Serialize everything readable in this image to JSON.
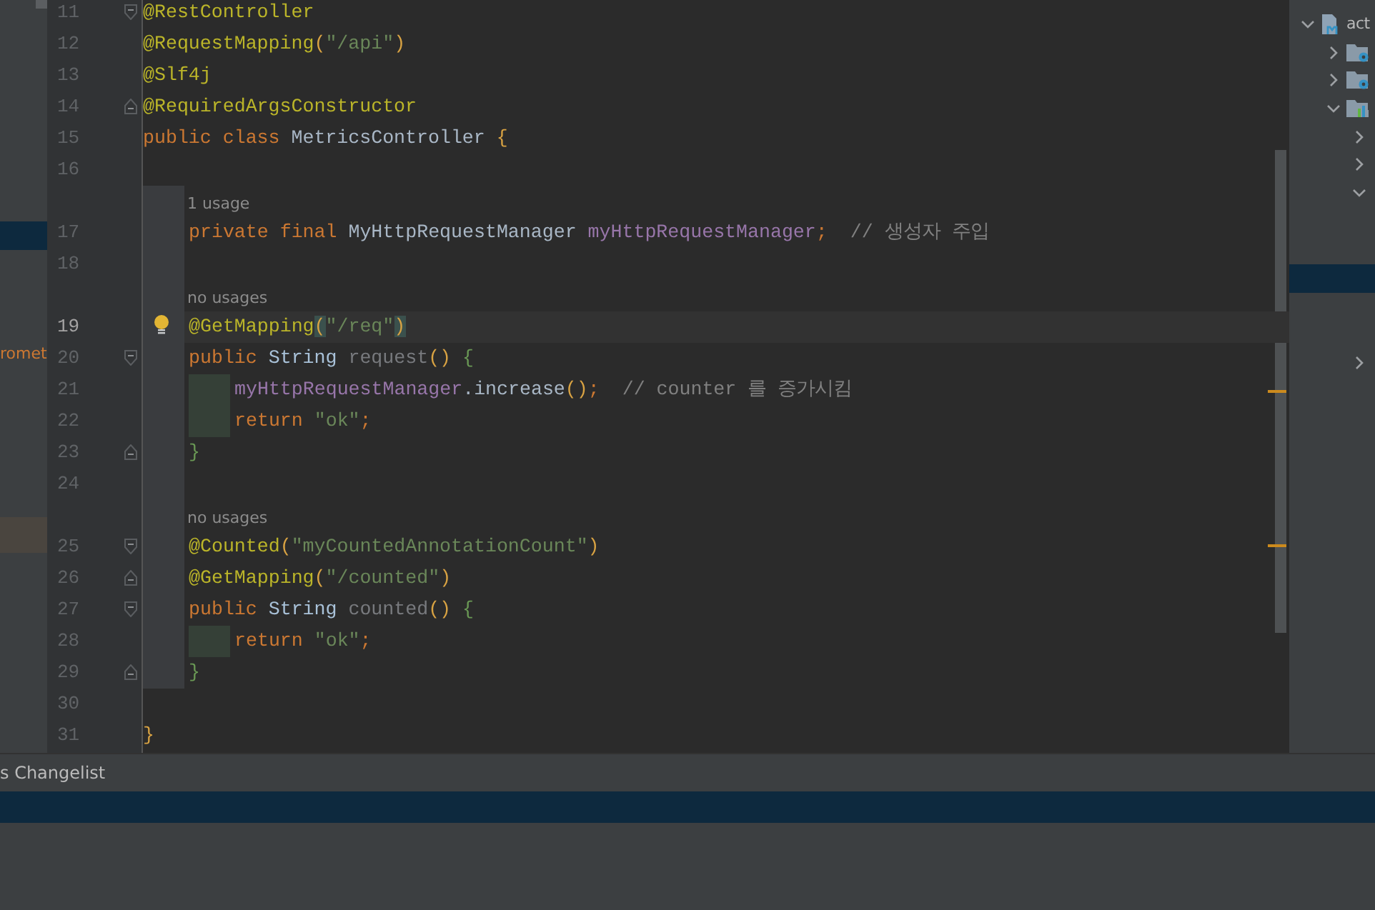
{
  "project_panel": {
    "items": [
      {
        "kind": "selection",
        "selected": true
      },
      {
        "kind": "label",
        "label": "romet"
      },
      {
        "kind": "highlight",
        "selected": false
      }
    ]
  },
  "editor": {
    "lines": [
      {
        "kind": "code",
        "number": "11",
        "fold_start": true,
        "tokens": [
          {
            "kind": "annotation",
            "text": "@RestController"
          }
        ]
      },
      {
        "kind": "code",
        "number": "12",
        "tokens": [
          {
            "kind": "annotation",
            "text": "@RequestMapping"
          },
          {
            "kind": "paren",
            "text": "("
          },
          {
            "kind": "string",
            "text": "\"/api\""
          },
          {
            "kind": "paren",
            "text": ")"
          }
        ]
      },
      {
        "kind": "code",
        "number": "13",
        "tokens": [
          {
            "kind": "annotation",
            "text": "@Slf4j"
          }
        ]
      },
      {
        "kind": "code",
        "number": "14",
        "fold_end": true,
        "tokens": [
          {
            "kind": "annotation",
            "text": "@RequiredArgsConstructor"
          }
        ]
      },
      {
        "kind": "code",
        "number": "15",
        "tokens": [
          {
            "kind": "keyword",
            "text": "public class "
          },
          {
            "kind": "plain",
            "text": "MetricsController "
          },
          {
            "kind": "paren",
            "text": "{"
          }
        ]
      },
      {
        "kind": "code",
        "number": "16"
      },
      {
        "kind": "hint",
        "text": "1 usage",
        "class_guide": true
      },
      {
        "kind": "code",
        "number": "17",
        "class_guide": true,
        "tokens": [
          {
            "kind": "keyword",
            "text": "private final "
          },
          {
            "kind": "plain",
            "text": "MyHttpRequestManager "
          },
          {
            "kind": "field",
            "text": "myHttpRequestManager"
          },
          {
            "kind": "keyword",
            "text": ";"
          },
          {
            "kind": "comment",
            "text": "  // 생성자 주입"
          }
        ]
      },
      {
        "kind": "code",
        "number": "18",
        "class_guide": true
      },
      {
        "kind": "hint",
        "text": "no usages",
        "class_guide": true
      },
      {
        "kind": "code",
        "number": "19",
        "current": true,
        "bulb": true,
        "class_guide": true,
        "tokens": [
          {
            "kind": "annotation",
            "text": "@GetMapping"
          },
          {
            "kind": "paren",
            "text": "(",
            "matched": true
          },
          {
            "kind": "string",
            "text": "\"/req\""
          },
          {
            "kind": "paren",
            "text": ")",
            "matched": true
          }
        ]
      },
      {
        "kind": "code",
        "number": "20",
        "fold_start": true,
        "class_guide": true,
        "tokens": [
          {
            "kind": "keyword",
            "text": "public "
          },
          {
            "kind": "type",
            "text": "String "
          },
          {
            "kind": "unused",
            "text": "request"
          },
          {
            "kind": "paren",
            "text": "()"
          },
          {
            "kind": "brace",
            "text": " {"
          }
        ]
      },
      {
        "kind": "code",
        "number": "21",
        "class_guide": true,
        "method_guide": true,
        "tokens": [
          {
            "kind": "field",
            "text": "myHttpRequestManager"
          },
          {
            "kind": "plain",
            "text": ".increase"
          },
          {
            "kind": "paren",
            "text": "()"
          },
          {
            "kind": "keyword",
            "text": ";"
          },
          {
            "kind": "comment",
            "text": "  // counter 를 증가시킴"
          }
        ]
      },
      {
        "kind": "code",
        "number": "22",
        "class_guide": true,
        "method_guide": true,
        "tokens": [
          {
            "kind": "keyword",
            "text": "return "
          },
          {
            "kind": "string",
            "text": "\"ok\""
          },
          {
            "kind": "keyword",
            "text": ";"
          }
        ]
      },
      {
        "kind": "code",
        "number": "23",
        "fold_end": true,
        "class_guide": true,
        "tokens": [
          {
            "kind": "brace",
            "text": "}"
          }
        ]
      },
      {
        "kind": "code",
        "number": "24",
        "class_guide": true
      },
      {
        "kind": "hint",
        "text": "no usages",
        "class_guide": true
      },
      {
        "kind": "code",
        "number": "25",
        "fold_start": true,
        "class_guide": true,
        "tokens": [
          {
            "kind": "annotation",
            "text": "@Counted"
          },
          {
            "kind": "paren",
            "text": "("
          },
          {
            "kind": "string",
            "text": "\"myCountedAnnotationCount\""
          },
          {
            "kind": "paren",
            "text": ")"
          }
        ]
      },
      {
        "kind": "code",
        "number": "26",
        "fold_end": true,
        "class_guide": true,
        "tokens": [
          {
            "kind": "annotation",
            "text": "@GetMapping"
          },
          {
            "kind": "paren",
            "text": "("
          },
          {
            "kind": "string",
            "text": "\"/counted\""
          },
          {
            "kind": "paren",
            "text": ")"
          }
        ]
      },
      {
        "kind": "code",
        "number": "27",
        "fold_start": true,
        "class_guide": true,
        "tokens": [
          {
            "kind": "keyword",
            "text": "public "
          },
          {
            "kind": "type",
            "text": "String "
          },
          {
            "kind": "unused",
            "text": "counted"
          },
          {
            "kind": "paren",
            "text": "()"
          },
          {
            "kind": "brace",
            "text": " {"
          }
        ]
      },
      {
        "kind": "code",
        "number": "28",
        "class_guide": true,
        "method_guide": true,
        "tokens": [
          {
            "kind": "keyword",
            "text": "return "
          },
          {
            "kind": "string",
            "text": "\"ok\""
          },
          {
            "kind": "keyword",
            "text": ";"
          }
        ]
      },
      {
        "kind": "code",
        "number": "29",
        "fold_end": true,
        "class_guide": true,
        "tokens": [
          {
            "kind": "brace",
            "text": "}"
          }
        ]
      },
      {
        "kind": "code",
        "number": "30"
      },
      {
        "kind": "code",
        "number": "31",
        "tokens": [
          {
            "kind": "paren",
            "text": "}"
          }
        ]
      }
    ]
  },
  "project_tree": [
    {
      "expanded": true,
      "kind": "module",
      "label": "act",
      "children": [
        {
          "expanded": false,
          "kind": "gear-folder"
        },
        {
          "expanded": false,
          "kind": "gear-folder"
        },
        {
          "expanded": true,
          "kind": "chart-folder",
          "children": [
            {
              "expanded": false
            },
            {
              "expanded": false
            },
            {
              "expanded": true,
              "children": [
                {
                  "selected": true
                }
              ]
            },
            {
              "expanded": false
            }
          ]
        }
      ]
    }
  ],
  "bottom_panel": {
    "tab": "s Changelist",
    "rows": [
      {
        "selected": true
      }
    ]
  }
}
